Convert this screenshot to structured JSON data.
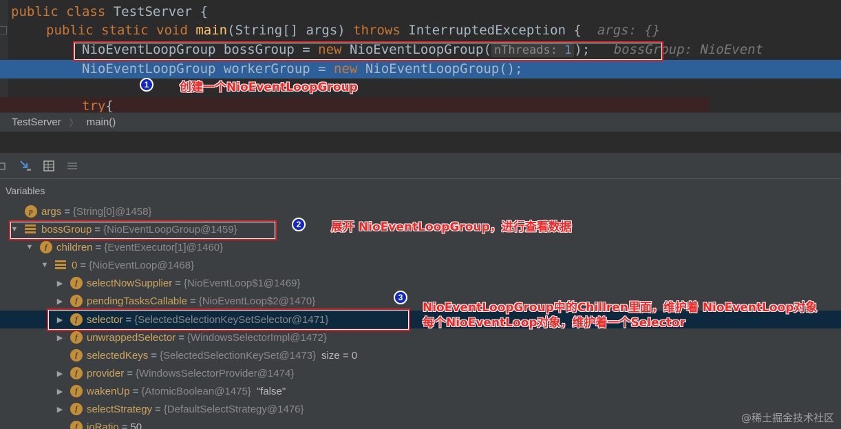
{
  "editor": {
    "line1": {
      "kw": "public class",
      "name": "TestServer",
      "brace": "{"
    },
    "line2": {
      "kw1": "public static void",
      "fn": "main",
      "params": "(String[] args)",
      "kw2": "throws",
      "exc": "InterruptedException {",
      "hint": "args: {}"
    },
    "line3": {
      "type": "NioEventLoopGroup bossGroup = ",
      "kw": "new",
      "ctor": "NioEventLoopGroup(",
      "param_hint": "nThreads:",
      "arg": "1",
      "tail": ");",
      "hint": "bossGroup: NioEvent"
    },
    "line4": {
      "type": "NioEventLoopGroup workerGroup = ",
      "kw": "new",
      "ctor": "NioEventLoopGroup();"
    },
    "line6": {
      "kw": "try",
      "brace": "{"
    }
  },
  "breadcrumb": {
    "class": "TestServer",
    "method": "main()"
  },
  "toolbar": {
    "icons": [
      "stop-icon",
      "step-cursor-icon",
      "table-icon",
      "settings-list-icon"
    ]
  },
  "variables": {
    "header": "Variables",
    "rows": [
      {
        "name": "args",
        "value": "{String[0]@1458}"
      },
      {
        "name": "bossGroup",
        "value": "{NioEventLoopGroup@1459}"
      },
      {
        "name": "children",
        "value": "{EventExecutor[1]@1460}"
      },
      {
        "name": "0",
        "value": "{NioEventLoop@1468}"
      },
      {
        "name": "selectNowSupplier",
        "value": "{NioEventLoop$1@1469}"
      },
      {
        "name": "pendingTasksCallable",
        "value": "{NioEventLoop$2@1470}"
      },
      {
        "name": "selector",
        "value": "{SelectedSelectionKeySetSelector@1471}"
      },
      {
        "name": "unwrappedSelector",
        "value": "{WindowsSelectorImpl@1472}"
      },
      {
        "name": "selectedKeys",
        "value": "{SelectedSelectionKeySet@1473}",
        "extra": "size = 0"
      },
      {
        "name": "provider",
        "value": "{WindowsSelectorProvider@1474}"
      },
      {
        "name": "wakenUp",
        "value": "{AtomicBoolean@1475}",
        "extra": "\"false\""
      },
      {
        "name": "selectStrategy",
        "value": "{DefaultSelectStrategy@1476}"
      },
      {
        "name": "ioRatio",
        "value": "50"
      }
    ]
  },
  "annotations": {
    "n1": "1",
    "note1": "创建一个NioEventLoopGroup",
    "n2": "2",
    "note2": "展开 NioEventLoopGroup，进行查看数据",
    "n3": "3",
    "note3a": "NioEventLoopGroup中的Chillren里面，维护着 NioEventLoop对象",
    "note3b": "每个NioEventLoop对象，维护着一个Selector"
  },
  "watermark": "@稀土掘金技术社区",
  "colors": {
    "accent_red": "#e02020",
    "selection_blue": "#2d6099",
    "badge": "#c38e36"
  }
}
